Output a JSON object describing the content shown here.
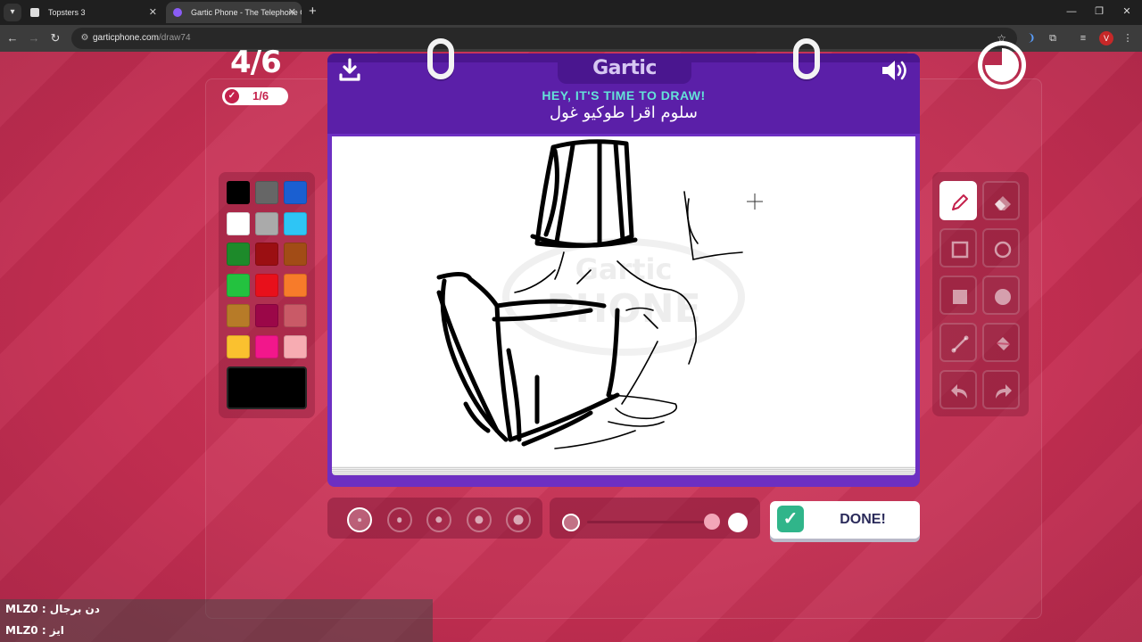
{
  "browser": {
    "tabs": [
      {
        "title": "Topsters 3",
        "active": false
      },
      {
        "title": "Gartic Phone - The Telephone Game",
        "active": true
      }
    ],
    "new_tab": "+",
    "address": {
      "domain": "garticphone.com",
      "path": "/draw74"
    },
    "profile_initial": "V",
    "window_controls": {
      "minimize": "—",
      "restore": "❐",
      "close": "✕"
    }
  },
  "game": {
    "round": "4/6",
    "players_done": "1/6",
    "logo": "Gartic",
    "prompt_title": "HEY, IT'S TIME TO DRAW!",
    "prompt_word": "سلوم اقرا طوكيو غول",
    "watermark": "Gartic PHONE",
    "timer_progress": 0.75,
    "done_label": "DONE!",
    "current_color": "#000000",
    "selected_brush_size": 1,
    "palette": [
      "#000000",
      "#666666",
      "#1a5fd1",
      "#ffffff",
      "#aaaaaa",
      "#2ec5f5",
      "#1d8a2a",
      "#9b0f12",
      "#a24c16",
      "#23c23f",
      "#e8101b",
      "#f77b2a",
      "#b77b28",
      "#9b0748",
      "#c95a67",
      "#fac12f",
      "#f2178b",
      "#f7acb2"
    ],
    "tools": [
      {
        "name": "pencil",
        "active": true
      },
      {
        "name": "eraser",
        "active": false
      },
      {
        "name": "rectangle-outline",
        "active": false
      },
      {
        "name": "ellipse-outline",
        "active": false
      },
      {
        "name": "rectangle-filled",
        "active": false
      },
      {
        "name": "ellipse-filled",
        "active": false
      },
      {
        "name": "line",
        "active": false
      },
      {
        "name": "fill-bucket",
        "active": false
      },
      {
        "name": "undo",
        "active": false
      },
      {
        "name": "redo",
        "active": false
      }
    ],
    "brush_sizes": [
      1,
      2,
      3,
      4,
      5
    ]
  },
  "chat": [
    {
      "text": "MLZ0 : دن برجال"
    },
    {
      "text": "MLZ0 : ايز"
    }
  ]
}
